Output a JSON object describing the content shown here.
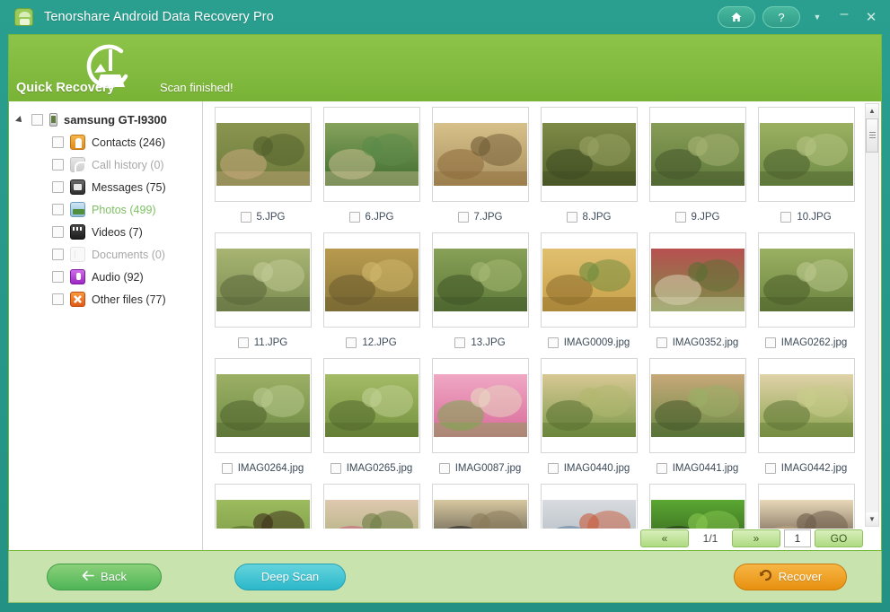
{
  "window": {
    "title": "Tenorshare Android Data Recovery Pro",
    "app_icon": "android-robot-icon",
    "controls": {
      "home": "home-icon",
      "help": "?",
      "caret": "▼",
      "minimize": "–",
      "close": "✕"
    }
  },
  "banner": {
    "mode_label": "Quick Recovery",
    "mode_icon": "broom-refresh-icon",
    "status": "Scan finished!",
    "color": "#86bf40"
  },
  "sidebar": {
    "device": {
      "label": "samsung GT-I9300",
      "icon": "phone-icon",
      "expanded": true,
      "checked": false
    },
    "items": [
      {
        "label": "Contacts (246)",
        "icon": "contacts-icon",
        "enabled": true,
        "selected": false
      },
      {
        "label": "Call history (0)",
        "icon": "call-history-icon",
        "enabled": false,
        "selected": false
      },
      {
        "label": "Messages (75)",
        "icon": "messages-icon",
        "enabled": true,
        "selected": false
      },
      {
        "label": "Photos (499)",
        "icon": "photos-icon",
        "enabled": true,
        "selected": true
      },
      {
        "label": "Videos (7)",
        "icon": "videos-icon",
        "enabled": true,
        "selected": false
      },
      {
        "label": "Documents (0)",
        "icon": "documents-icon",
        "enabled": false,
        "selected": false
      },
      {
        "label": "Audio (92)",
        "icon": "audio-icon",
        "enabled": true,
        "selected": false
      },
      {
        "label": "Other files (77)",
        "icon": "other-files-icon",
        "enabled": true,
        "selected": false
      }
    ]
  },
  "grid": {
    "items": [
      {
        "name": "5.JPG",
        "checked": false,
        "scene": "kids-swimming-river"
      },
      {
        "name": "6.JPG",
        "checked": false,
        "scene": "kids-on-bench-by-lake"
      },
      {
        "name": "7.JPG",
        "checked": false,
        "scene": "boy-with-apple-basket"
      },
      {
        "name": "8.JPG",
        "checked": false,
        "scene": "children-climbing-tree"
      },
      {
        "name": "9.JPG",
        "checked": false,
        "scene": "children-by-trees"
      },
      {
        "name": "10.JPG",
        "checked": false,
        "scene": "kids-running-field"
      },
      {
        "name": "11.JPG",
        "checked": false,
        "scene": "children-backs-in-field"
      },
      {
        "name": "12.JPG",
        "checked": false,
        "scene": "kids-lying-autumn-grass"
      },
      {
        "name": "13.JPG",
        "checked": false,
        "scene": "children-on-swing-frame"
      },
      {
        "name": "IMAG0009.jpg",
        "checked": false,
        "scene": "two-boys-closeup"
      },
      {
        "name": "IMAG0352.jpg",
        "checked": false,
        "scene": "two-children-hugging"
      },
      {
        "name": "IMAG0262.jpg",
        "checked": false,
        "scene": "boy-with-bicycle"
      },
      {
        "name": "IMAG0264.jpg",
        "checked": false,
        "scene": "family-sitting-grass"
      },
      {
        "name": "IMAG0265.jpg",
        "checked": false,
        "scene": "children-playing-meadow"
      },
      {
        "name": "IMAG0087.jpg",
        "checked": false,
        "scene": "girl-smiling-pink"
      },
      {
        "name": "IMAG0440.jpg",
        "checked": false,
        "scene": "labrador-lying-grass"
      },
      {
        "name": "IMAG0441.jpg",
        "checked": false,
        "scene": "two-boys-portrait"
      },
      {
        "name": "IMAG0442.jpg",
        "checked": false,
        "scene": "puppy-with-flower"
      },
      {
        "name": "",
        "checked": false,
        "scene": "dog-on-lawn"
      },
      {
        "name": "",
        "checked": false,
        "scene": "girls-with-flowers"
      },
      {
        "name": "",
        "checked": false,
        "scene": "golden-retriever-face"
      },
      {
        "name": "",
        "checked": false,
        "scene": "children-at-tent"
      },
      {
        "name": "",
        "checked": false,
        "scene": "green-caterpillar-plant"
      },
      {
        "name": "",
        "checked": false,
        "scene": "puppy-closeup"
      }
    ]
  },
  "pager": {
    "first_label": "«",
    "page_display": "1/1",
    "next_label": "»",
    "page_input": "1",
    "go_label": "GO"
  },
  "footer": {
    "back_label": "Back",
    "back_icon": "arrow-left-icon",
    "deep_scan_label": "Deep Scan",
    "recover_label": "Recover",
    "recover_icon": "undo-arrow-icon"
  },
  "colors": {
    "titlebar": "#27998a",
    "banner": "#86bf40",
    "footer": "#c9e3af",
    "recover": "#ef9a11",
    "deep_scan": "#2bb8c9",
    "back": "#56b85b",
    "selected_text": "#7dc063"
  }
}
